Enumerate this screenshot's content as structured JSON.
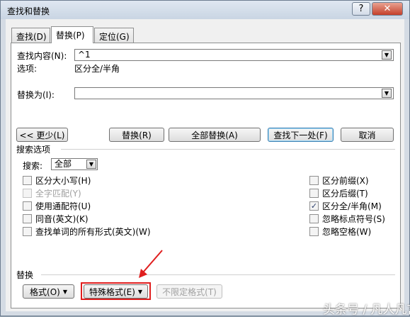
{
  "window": {
    "title": "查找和替换",
    "help_btn": "?",
    "close_btn": "✕"
  },
  "tabs": [
    {
      "label": "查找(D)"
    },
    {
      "label": "替换(P)"
    },
    {
      "label": "定位(G)"
    }
  ],
  "find": {
    "label": "查找内容(N):",
    "value": "^1",
    "options_label": "选项:",
    "options_value": "区分全/半角"
  },
  "replace": {
    "label": "替换为(I):",
    "value": ""
  },
  "buttons": {
    "less": "<< 更少(L)",
    "replace": "替换(R)",
    "replace_all": "全部替换(A)",
    "find_next": "查找下一处(F)",
    "cancel": "取消"
  },
  "search_options": {
    "header": "搜索选项",
    "search_label": "搜索:",
    "search_value": "全部",
    "left": [
      {
        "label": "区分大小写(H)",
        "checked": false,
        "disabled": false
      },
      {
        "label": "全字匹配(Y)",
        "checked": false,
        "disabled": true
      },
      {
        "label": "使用通配符(U)",
        "checked": false,
        "disabled": false
      },
      {
        "label": "同音(英文)(K)",
        "checked": false,
        "disabled": false
      },
      {
        "label": "查找单词的所有形式(英文)(W)",
        "checked": false,
        "disabled": false
      }
    ],
    "right": [
      {
        "label": "区分前缀(X)",
        "checked": false
      },
      {
        "label": "区分后缀(T)",
        "checked": false
      },
      {
        "label": "区分全/半角(M)",
        "checked": true
      },
      {
        "label": "忽略标点符号(S)",
        "checked": false
      },
      {
        "label": "忽略空格(W)",
        "checked": false
      }
    ]
  },
  "replace_section": {
    "header": "替换",
    "format": "格式(O)",
    "special": "特殊格式(E)",
    "no_format": "不限定格式(T)"
  },
  "watermark": "头条号 / 凡人凡言",
  "colors": {
    "highlight_box": "#e01e1e",
    "arrow": "#e01e1e"
  }
}
